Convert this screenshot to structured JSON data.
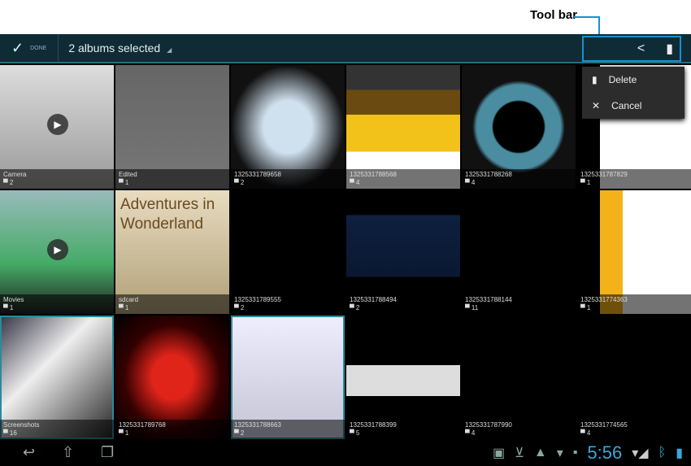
{
  "callout": {
    "label": "Tool bar"
  },
  "actionbar": {
    "done_label": "DONE",
    "selection_text": "2 albums selected"
  },
  "menu": {
    "items": [
      {
        "label": "Delete",
        "icon": "trash-icon"
      },
      {
        "label": "Cancel",
        "icon": "close-icon"
      }
    ]
  },
  "albums": [
    {
      "name": "Camera",
      "count": "2"
    },
    {
      "name": "Edited",
      "count": "1"
    },
    {
      "name": "1325331789658",
      "count": "2"
    },
    {
      "name": "1325331788568",
      "count": "4"
    },
    {
      "name": "1325331788268",
      "count": "4"
    },
    {
      "name": "1325331787829",
      "count": "1"
    },
    {
      "name": "Movies",
      "count": "1"
    },
    {
      "name": "sdcard",
      "count": "1"
    },
    {
      "name": "1325331789555",
      "count": "2"
    },
    {
      "name": "1325331788494",
      "count": "2"
    },
    {
      "name": "1325331788144",
      "count": "11"
    },
    {
      "name": "1325331774363",
      "count": "1"
    },
    {
      "name": "Screenshots",
      "count": "16"
    },
    {
      "name": "1325331789768",
      "count": "1"
    },
    {
      "name": "1325331788663",
      "count": "2"
    },
    {
      "name": "1325331788399",
      "count": "5"
    },
    {
      "name": "1325331787990",
      "count": "4"
    },
    {
      "name": "1325331774565",
      "count": "4"
    }
  ],
  "sdcard_thumb_text": "Adventures in Wonderland",
  "status": {
    "time": "5:56"
  }
}
